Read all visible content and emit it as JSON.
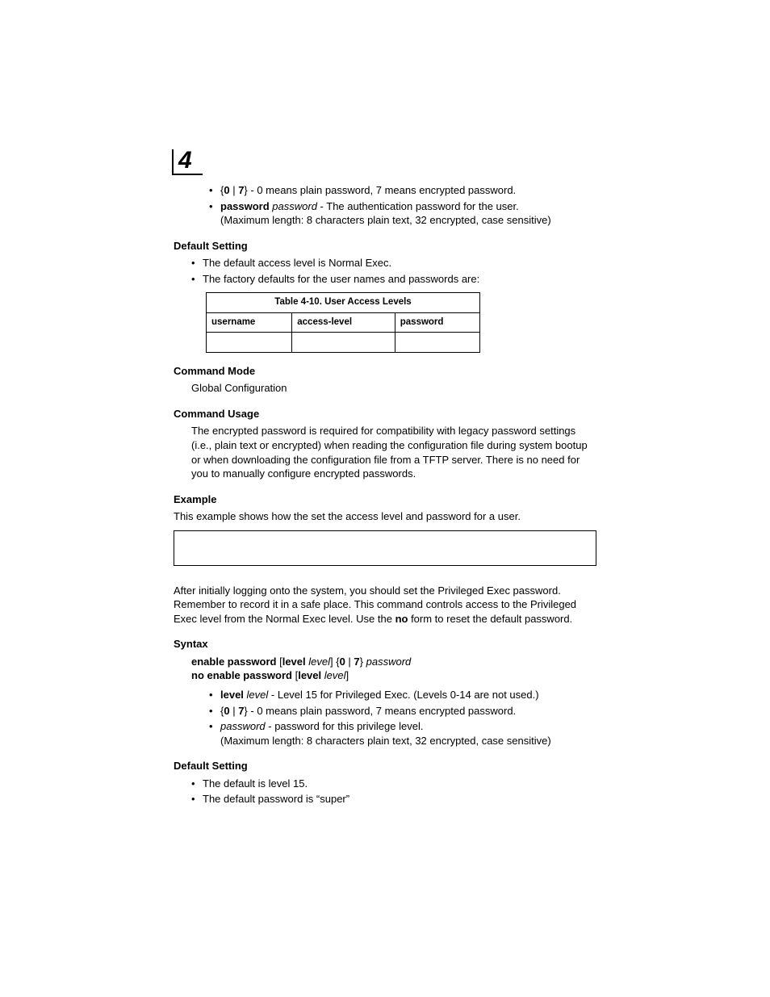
{
  "chapter_number": "4",
  "top_bullets": {
    "item1_prefix_open": "{",
    "item1_zero": "0",
    "item1_pipe": " | ",
    "item1_seven": "7",
    "item1_prefix_close": "} - ",
    "item1_rest": "0 means plain password, 7 means encrypted password.",
    "item2_bold": "password",
    "item2_ital": " password",
    "item2_rest": " - The authentication password for the user.",
    "item2_line2": "(Maximum length: 8 characters plain text, 32 encrypted, case sensitive)"
  },
  "default_setting_1": {
    "heading": "Default Setting",
    "b1": "The default access level is Normal Exec.",
    "b2": "The factory defaults for the user names and passwords are:"
  },
  "table": {
    "caption": "Table 4-10.  User Access Levels",
    "h1": "username",
    "h2": "access-level",
    "h3": "password"
  },
  "cmd_mode": {
    "heading": "Command Mode",
    "text": "Global Configuration"
  },
  "cmd_usage": {
    "heading": "Command Usage",
    "text": "The encrypted password is required for compatibility with legacy password settings (i.e., plain text or encrypted) when reading the configuration file during system bootup or when downloading the configuration file from a TFTP server. There is no need for you to manually configure encrypted passwords."
  },
  "example": {
    "heading": "Example",
    "text": "This example shows how the set the access level and password for a user."
  },
  "enable_pw": {
    "intro_a": "After initially logging onto the system, you should set the Privileged Exec password. Remember to record it in a safe place. This command controls access to the Privileged Exec level from the Normal Exec level. Use the ",
    "intro_no": "no",
    "intro_b": " form to reset the default password."
  },
  "syntax": {
    "heading": "Syntax",
    "l1_a": "enable password",
    "l1_b": " [",
    "l1_c": "level",
    "l1_d": " level",
    "l1_e": "] {",
    "l1_f": "0",
    "l1_g": " | ",
    "l1_h": "7",
    "l1_i": "} ",
    "l1_j": "password",
    "l2_a": "no enable password",
    "l2_b": " [",
    "l2_c": "level",
    "l2_d": " level",
    "l2_e": "]"
  },
  "syntax_bullets": {
    "b1_a": "level",
    "b1_b": " level",
    "b1_c": " - Level 15 for Privileged Exec. (Levels 0-14 are not used.)",
    "b2_open": "{",
    "b2_zero": "0",
    "b2_pipe": " | ",
    "b2_seven": "7",
    "b2_close": "} - ",
    "b2_rest": "0 means plain password, 7 means encrypted password.",
    "b3_a": "password",
    "b3_b": " - password for this privilege level.",
    "b3_line2": "(Maximum length: 8 characters plain text, 32 encrypted, case sensitive)"
  },
  "default_setting_2": {
    "heading": "Default Setting",
    "b1": "The default is level 15.",
    "b2": "The default password is “super”"
  }
}
